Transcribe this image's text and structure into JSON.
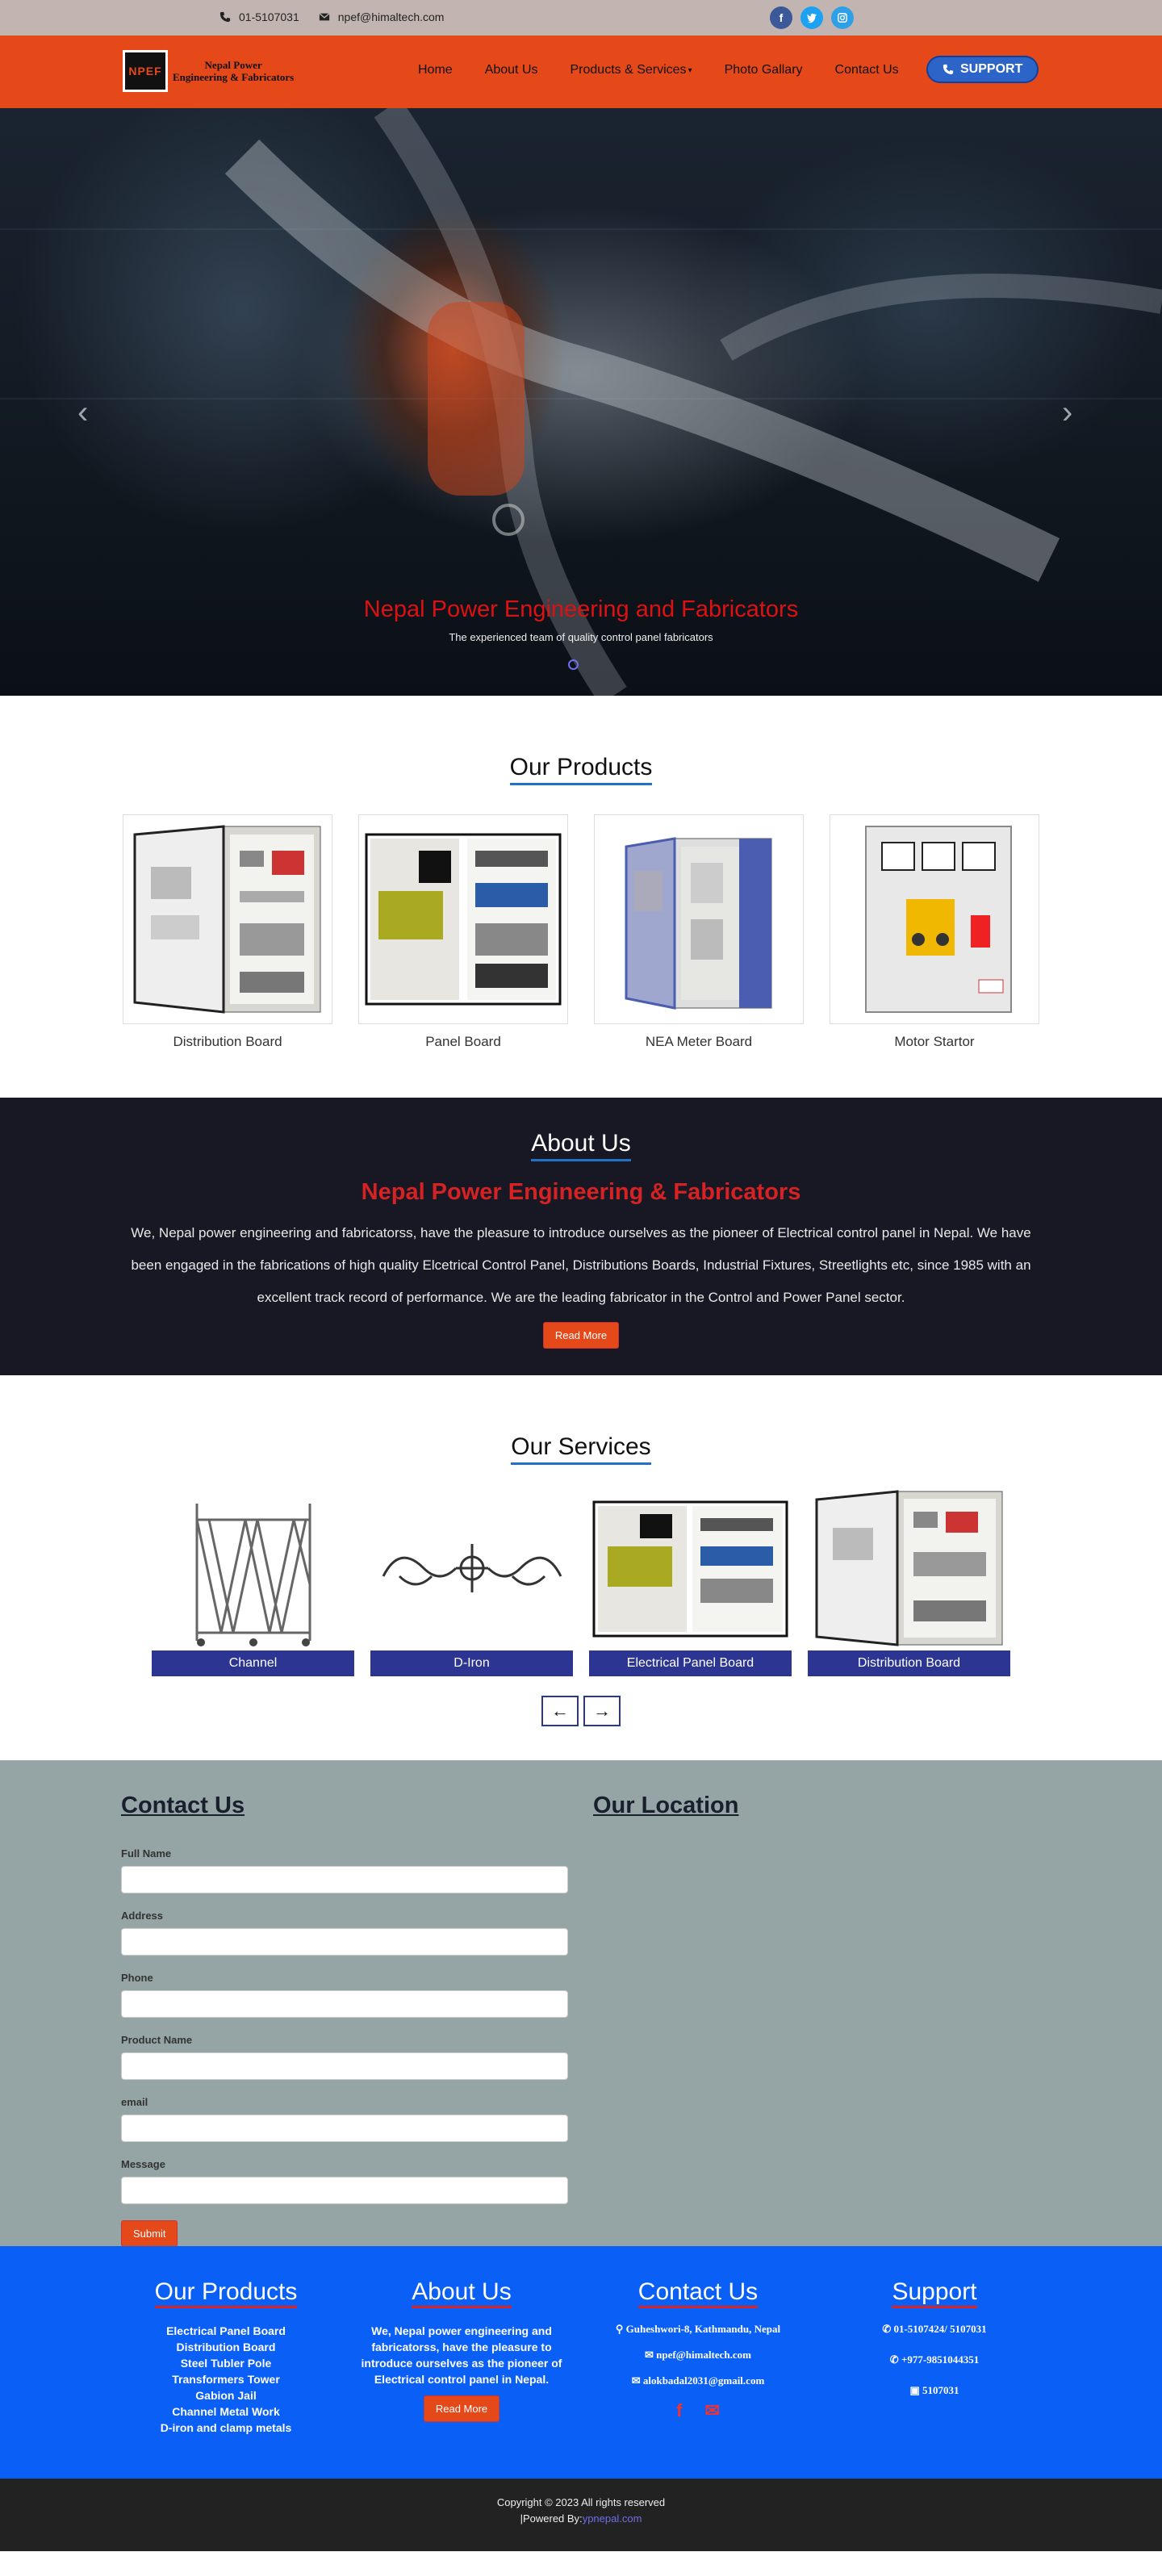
{
  "topbar": {
    "phone": "01-5107031",
    "email": "npef@himaltech.com",
    "socials": [
      "facebook-icon",
      "twitter-icon",
      "instagram-icon"
    ]
  },
  "nav": {
    "logo_mark": "NPEF",
    "logo_line1": "Nepal Power",
    "logo_line2": "Engineering & Fabricators",
    "links": [
      "Home",
      "About Us",
      "Products & Services",
      "Photo Gallary",
      "Contact Us"
    ],
    "support": "SUPPORT"
  },
  "hero": {
    "title": "Nepal Power Engineering and Fabricators",
    "subtitle": "The experienced team of quality control panel fabricators"
  },
  "products": {
    "title": "Our Products",
    "items": [
      "Distribution Board",
      "Panel Board",
      "NEA Meter Board",
      "Motor Startor"
    ]
  },
  "about": {
    "title": "About Us",
    "heading": "Nepal Power Engineering & Fabricators",
    "body": "We, Nepal power engineering and fabricatorss, have the pleasure to introduce ourselves as the pioneer of Electrical control panel in Nepal. We have been engaged in the fabrications of high quality Elcetrical Control Panel, Distributions Boards, Industrial Fixtures, Streetlights etc, since 1985 with an excellent track record of performance. We are the leading fabricator in the Control and Power Panel sector.",
    "read_more": "Read More"
  },
  "services": {
    "title": "Our Services",
    "items": [
      "Channel",
      "D-Iron",
      "Electrical Panel Board",
      "Distribution Board"
    ]
  },
  "contact": {
    "title": "Contact Us",
    "location_title": "Our Location",
    "fields": [
      "Full Name",
      "Address",
      "Phone",
      "Product Name",
      "email",
      "Message"
    ],
    "submit": "Submit"
  },
  "footer": {
    "products_title": "Our Products",
    "products": [
      "Electrical Panel Board",
      "Distribution Board",
      "Steel Tubler Pole",
      "Transformers Tower",
      "Gabion Jail",
      "Channel Metal Work",
      "D-iron and clamp metals"
    ],
    "about_title": "About Us",
    "about_text": "We, Nepal power engineering and fabricatorss, have the pleasure to introduce ourselves as the pioneer of Electrical control panel in Nepal.",
    "about_button": "Read More",
    "contact_title": "Contact Us",
    "address": "Guheshwori-8, Kathmandu, Nepal",
    "email1": "npef@himaltech.com",
    "email2": "alokbadal2031@gmail.com",
    "support_title": "Support",
    "phone1": "01-5107424/ 5107031",
    "phone2": "+977-9851044351",
    "fax": "5107031"
  },
  "copyright": {
    "line1": "Copyright © 2023 All rights reserved",
    "powered_prefix": "|Powered By:",
    "powered_link": "ypnepal.com"
  }
}
